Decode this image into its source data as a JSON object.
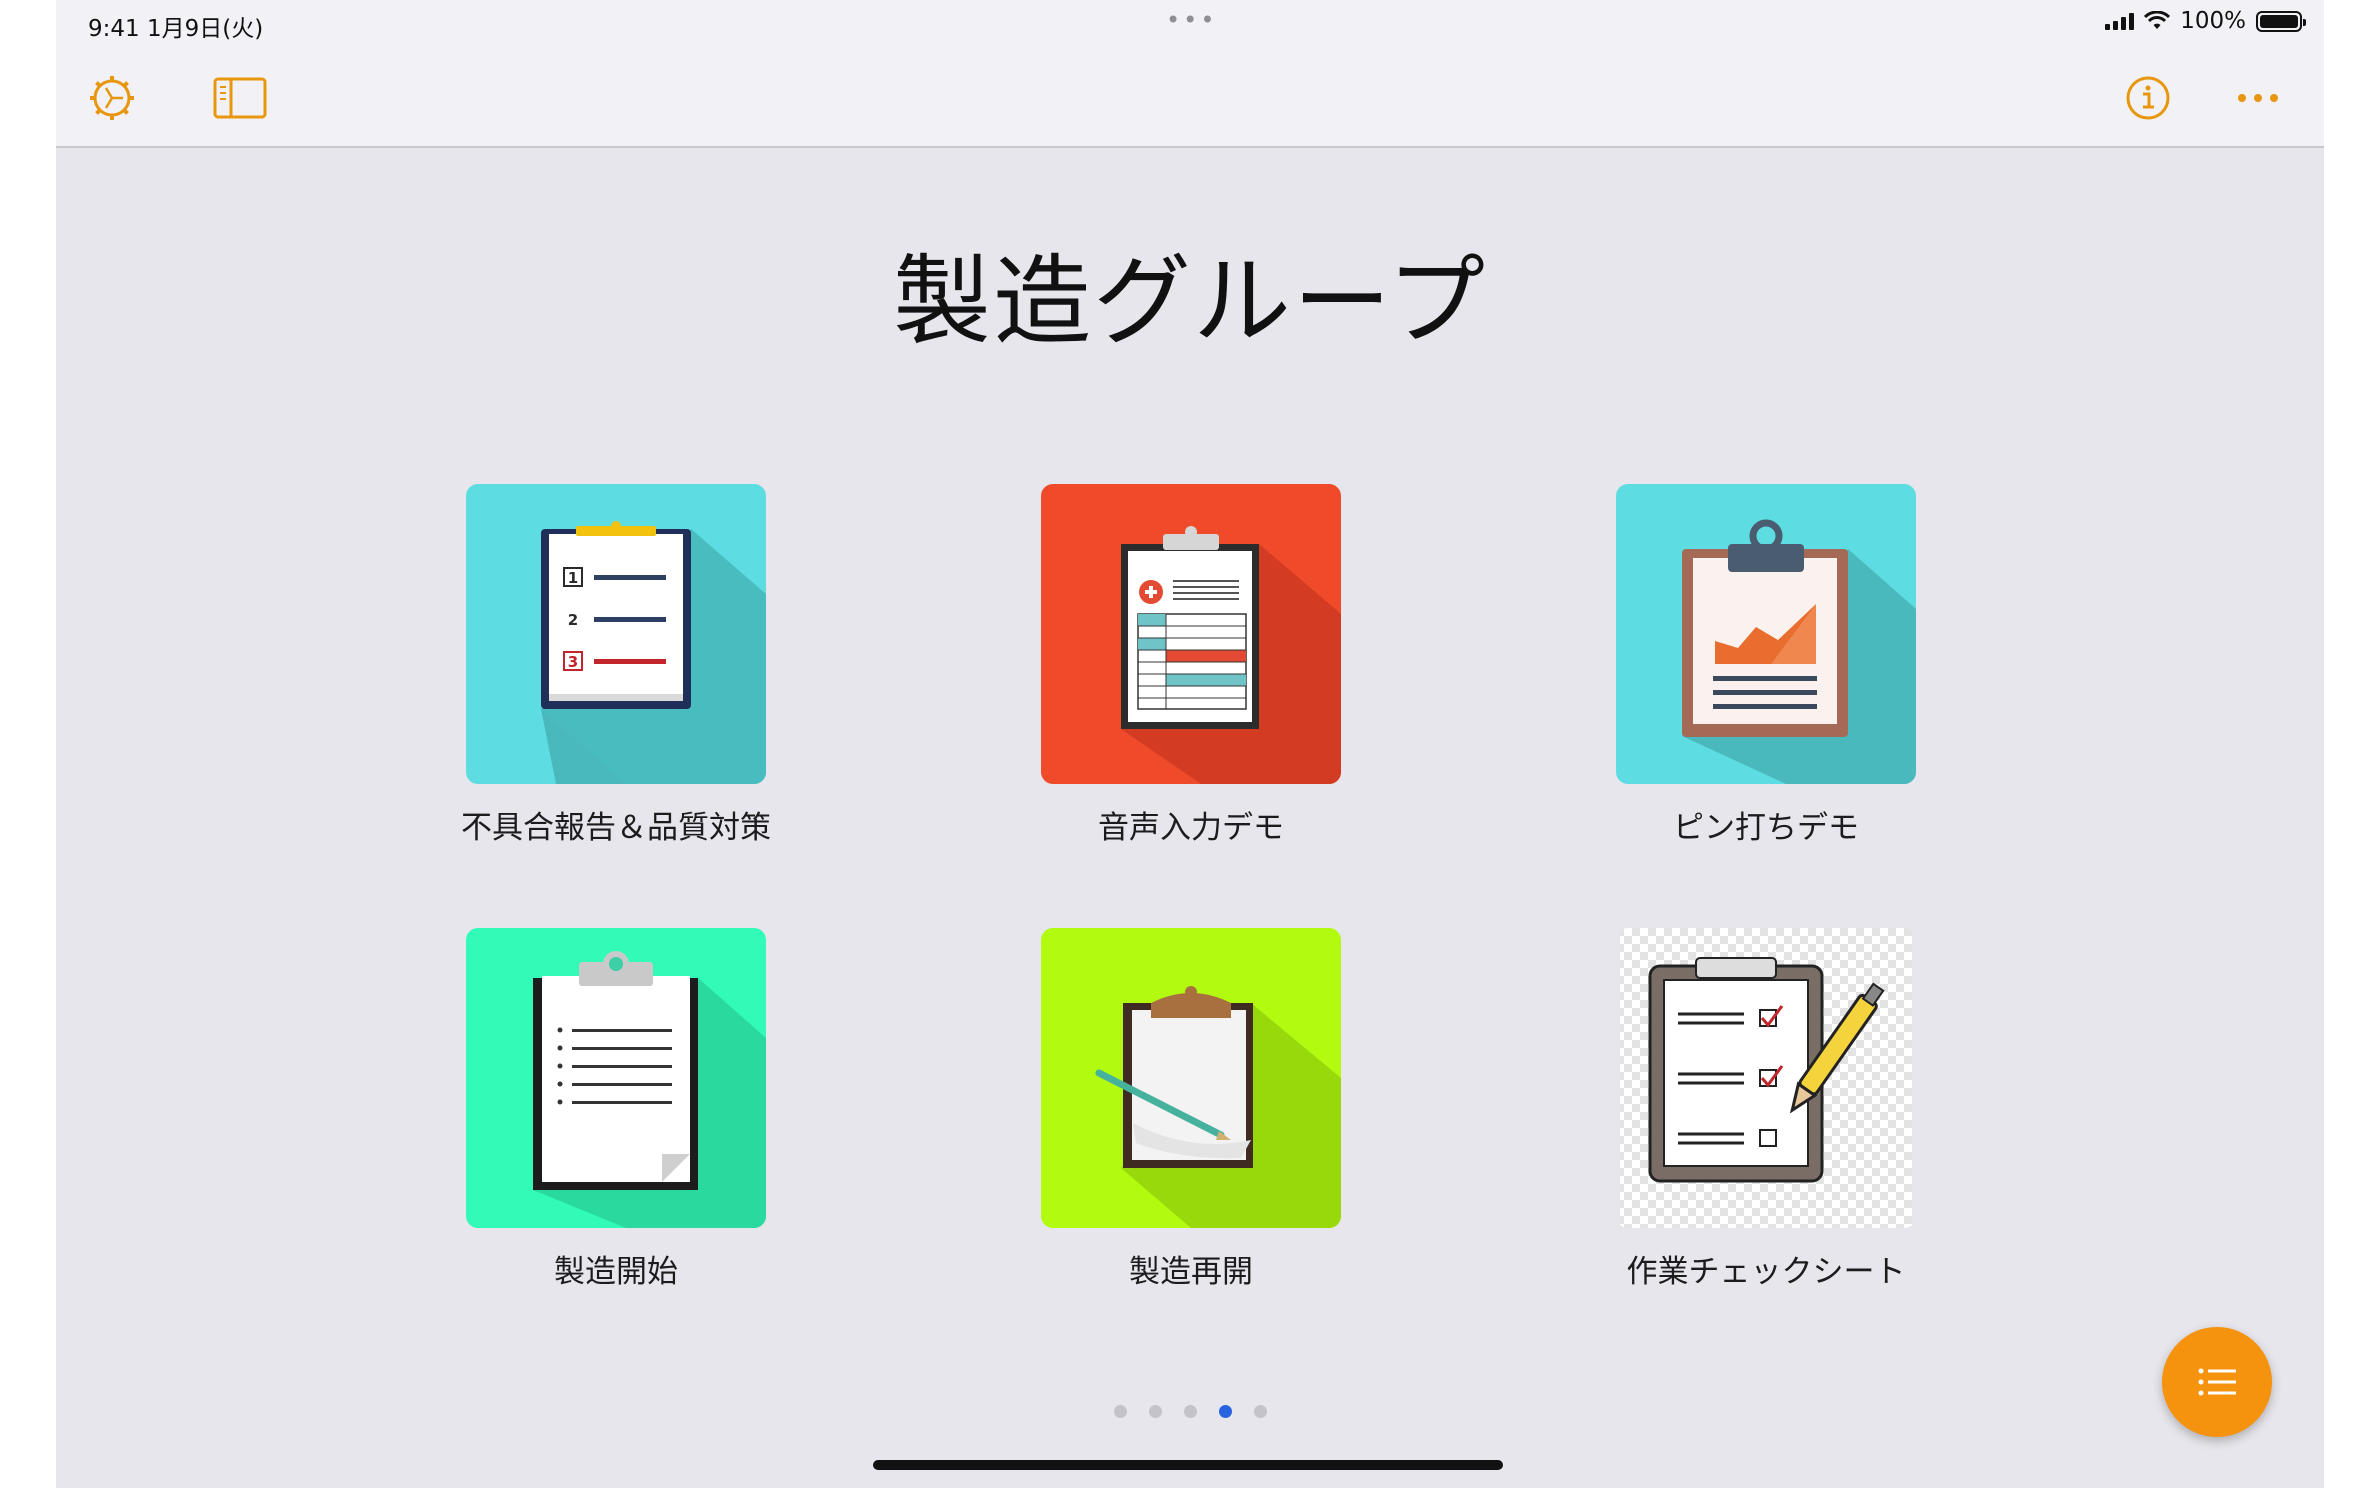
{
  "status_bar": {
    "time_date": "9:41   1月9日(火)",
    "battery": "100%"
  },
  "toolbar": {
    "icons": [
      "settings-gear-icon",
      "sidebar-toggle-icon",
      "info-icon",
      "more-icon"
    ],
    "accent_color": "#e8960e"
  },
  "page_title": "製造グループ",
  "apps": [
    {
      "label": "不具合報告＆品質対策",
      "bg": "#5ddde1",
      "icon": "numbered-list-clipboard-icon"
    },
    {
      "label": "音声入力デモ",
      "bg": "#ef4a2a",
      "icon": "medical-form-clipboard-icon"
    },
    {
      "label": "ピン打ちデモ",
      "bg": "#5ddde1",
      "icon": "chart-clipboard-icon"
    },
    {
      "label": "製造開始",
      "bg": "#31fbb7",
      "icon": "checklist-clipboard-icon"
    },
    {
      "label": "製造再開",
      "bg": "#b2fb10",
      "icon": "clipboard-pen-icon"
    },
    {
      "label": "作業チェックシート",
      "bg": "#ffffff",
      "icon": "check-sheet-pen-icon"
    }
  ],
  "pager": {
    "page_count": 5,
    "current_page": 4
  },
  "fab": {
    "icon": "list-icon",
    "color": "#f5930f"
  }
}
